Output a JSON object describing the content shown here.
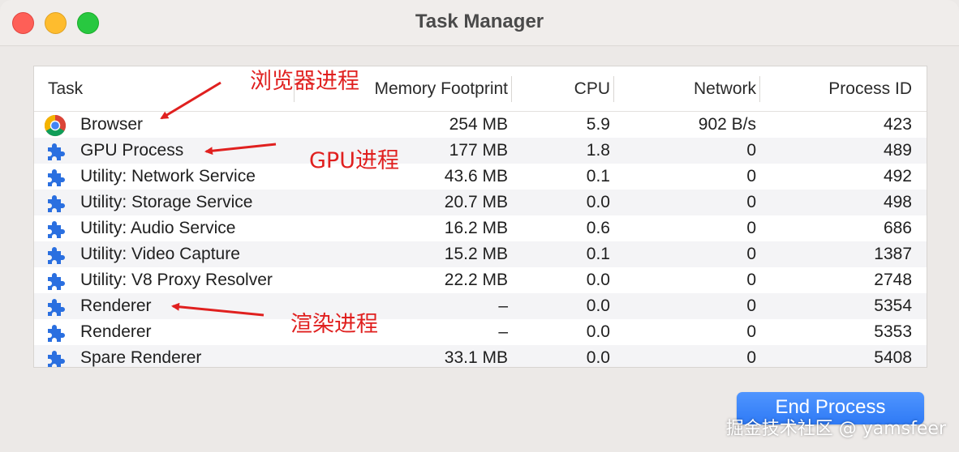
{
  "window": {
    "title": "Task Manager"
  },
  "columns": {
    "task": "Task",
    "memory": "Memory Footprint",
    "cpu": "CPU",
    "network": "Network",
    "pid": "Process ID"
  },
  "rows": [
    {
      "icon": "chrome-icon",
      "task": "Browser",
      "memory": "254 MB",
      "cpu": "5.9",
      "network": "902 B/s",
      "pid": "423"
    },
    {
      "icon": "puzzle-piece-icon",
      "task": "GPU Process",
      "memory": "177 MB",
      "cpu": "1.8",
      "network": "0",
      "pid": "489"
    },
    {
      "icon": "puzzle-piece-icon",
      "task": "Utility: Network Service",
      "memory": "43.6 MB",
      "cpu": "0.1",
      "network": "0",
      "pid": "492"
    },
    {
      "icon": "puzzle-piece-icon",
      "task": "Utility: Storage Service",
      "memory": "20.7 MB",
      "cpu": "0.0",
      "network": "0",
      "pid": "498"
    },
    {
      "icon": "puzzle-piece-icon",
      "task": "Utility: Audio Service",
      "memory": "16.2 MB",
      "cpu": "0.6",
      "network": "0",
      "pid": "686"
    },
    {
      "icon": "puzzle-piece-icon",
      "task": "Utility: Video Capture",
      "memory": "15.2 MB",
      "cpu": "0.1",
      "network": "0",
      "pid": "1387"
    },
    {
      "icon": "puzzle-piece-icon",
      "task": "Utility: V8 Proxy Resolver",
      "memory": "22.2 MB",
      "cpu": "0.0",
      "network": "0",
      "pid": "2748"
    },
    {
      "icon": "puzzle-piece-icon",
      "task": "Renderer",
      "memory": "–",
      "cpu": "0.0",
      "network": "0",
      "pid": "5354"
    },
    {
      "icon": "puzzle-piece-icon",
      "task": "Renderer",
      "memory": "–",
      "cpu": "0.0",
      "network": "0",
      "pid": "5353"
    },
    {
      "icon": "puzzle-piece-icon",
      "task": "Spare Renderer",
      "memory": "33.1 MB",
      "cpu": "0.0",
      "network": "0",
      "pid": "5408"
    }
  ],
  "buttons": {
    "end_process": "End Process"
  },
  "annotations": {
    "browser": "浏览器进程",
    "gpu": "GPU进程",
    "renderer": "渲染进程"
  },
  "watermark": "掘金技术社区 @ yamsfeer",
  "colors": {
    "accent": "#2f7af5",
    "annotation": "#e0201f",
    "puzzle": "#2a6fe0"
  }
}
